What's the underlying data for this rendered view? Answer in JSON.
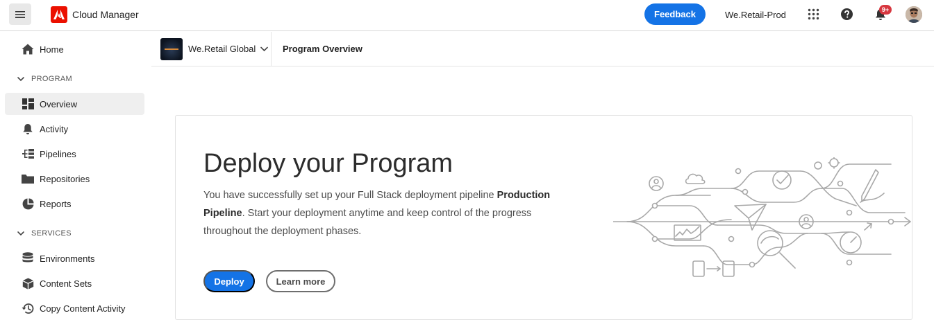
{
  "topbar": {
    "app_title": "Cloud Manager",
    "feedback_label": "Feedback",
    "org_name": "We.Retail-Prod",
    "notifications_count": "9+"
  },
  "sidebar": {
    "home": "Home",
    "program_section": "PROGRAM",
    "program_items": [
      "Overview",
      "Activity",
      "Pipelines",
      "Repositories",
      "Reports"
    ],
    "services_section": "SERVICES",
    "services_items": [
      "Environments",
      "Content Sets",
      "Copy Content Activity"
    ],
    "active_item": "Overview"
  },
  "subheader": {
    "program_name": "We.Retail Global",
    "page_title": "Program Overview"
  },
  "card": {
    "title": "Deploy your Program",
    "desc_part1": "You have successfully set up your Full Stack deployment pipeline ",
    "desc_bold": "Production Pipeline",
    "desc_part2": ". Start your deployment anytime and keep control of the progress throughout the deployment phases.",
    "deploy_label": "Deploy",
    "learn_label": "Learn more"
  },
  "colors": {
    "accent": "#1473e6",
    "adobe_red": "#eb1000",
    "badge": "#d7373f"
  },
  "icons": {
    "menu": "hamburger-icon",
    "home": "home-icon",
    "overview": "dashboard-icon",
    "activity": "bell-icon",
    "pipelines": "pipeline-icon",
    "repositories": "folder-icon",
    "reports": "pie-chart-icon",
    "environments": "database-icon",
    "content_sets": "box-icon",
    "copy_activity": "history-icon"
  }
}
